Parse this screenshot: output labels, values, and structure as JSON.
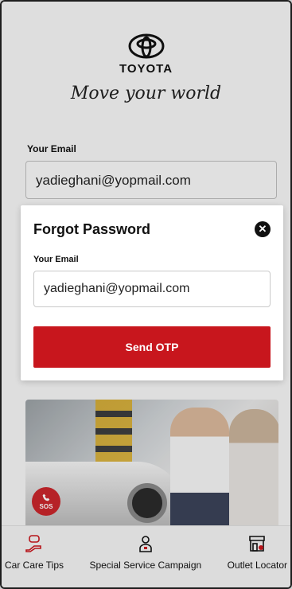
{
  "brand": {
    "name": "TOYOTA",
    "tagline": "Move your world"
  },
  "login": {
    "email_label": "Your Email",
    "email_value": "yadieghani@yopmail.com"
  },
  "modal": {
    "title": "Forgot Password",
    "email_label": "Your Email",
    "email_value": "yadieghani@yopmail.com",
    "send_label": "Send OTP",
    "close_icon": "close-icon"
  },
  "banner": {
    "sos_label": "SOS"
  },
  "bottom_nav": {
    "items": [
      {
        "label": "Car Care Tips",
        "icon": "car-care-icon"
      },
      {
        "label": "Special Service Campaign",
        "icon": "mechanic-icon"
      },
      {
        "label": "Outlet Locator",
        "icon": "store-icon"
      }
    ]
  },
  "colors": {
    "accent": "#c8161d",
    "close_button": "#111111"
  }
}
